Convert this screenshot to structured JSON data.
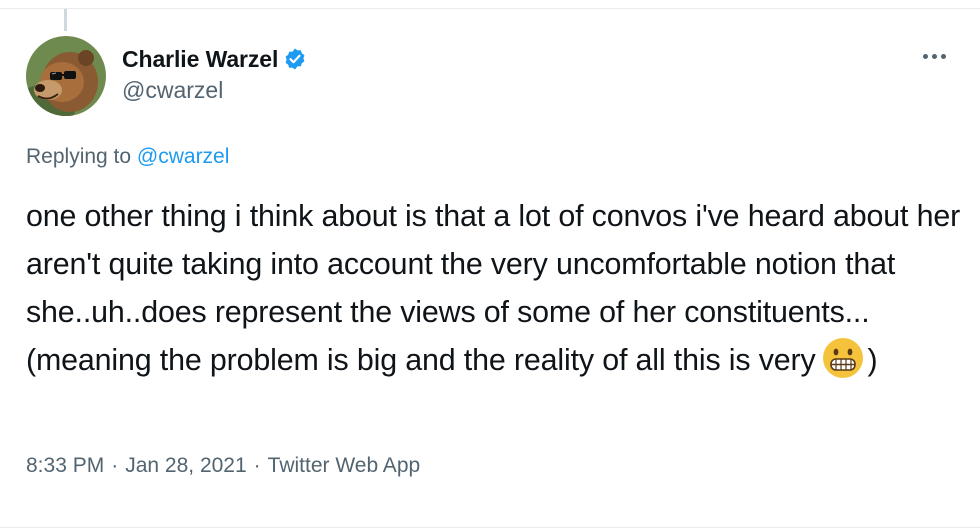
{
  "author": {
    "display_name": "Charlie Warzel",
    "handle": "@cwarzel",
    "verified": true,
    "avatar_icon": "bear-avatar"
  },
  "reply": {
    "prefix": "Replying to",
    "mention": "@cwarzel"
  },
  "tweet": {
    "text_before_emoji": "one other thing i think about is that a lot of convos i've heard about her aren't quite taking into account the very uncomfortable notion that she..uh..does represent the views of some of her constituents...(meaning the problem is big and the reality of all this is very",
    "emoji": "grimacing-face-emoji",
    "text_after_emoji": ")"
  },
  "meta": {
    "time": "8:33 PM",
    "separator": "·",
    "date": "Jan 28, 2021",
    "source": "Twitter Web App"
  },
  "colors": {
    "link": "#1d9bf0",
    "secondary_text": "#536471",
    "primary_text": "#0f1419",
    "verified_badge": "#1d9bf0"
  }
}
